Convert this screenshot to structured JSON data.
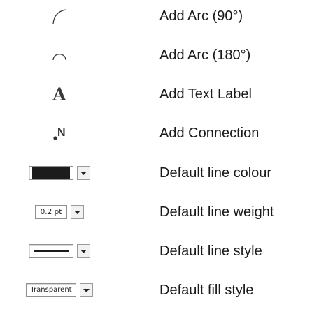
{
  "tools": [
    {
      "icon": "arc-90-icon",
      "label": "Add Arc (90°)"
    },
    {
      "icon": "arc-180-icon",
      "label": "Add Arc (180°)"
    },
    {
      "icon": "text-label-icon",
      "glyph": "A",
      "label": "Add Text Label"
    },
    {
      "icon": "connection-icon",
      "glyph": "N",
      "label": "Add Connection"
    },
    {
      "control": "line-colour-dropdown",
      "value_color": "#1c1c1c",
      "label": "Default line colour"
    },
    {
      "control": "line-weight-dropdown",
      "value": "0.2 pt",
      "label": "Default line weight"
    },
    {
      "control": "line-style-dropdown",
      "value": "solid",
      "label": "Default line style"
    },
    {
      "control": "fill-style-dropdown",
      "value": "Transparent",
      "label": "Default fill style"
    }
  ]
}
